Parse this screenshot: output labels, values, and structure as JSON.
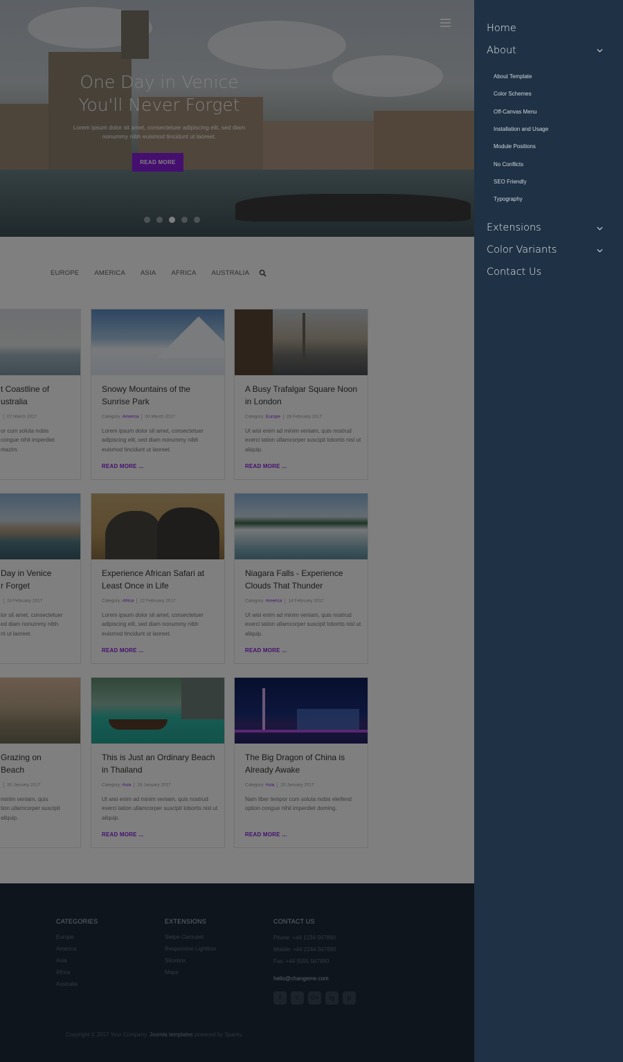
{
  "hero": {
    "title_line1": "One Day in Venice",
    "title_line2": "You'll Never Forget",
    "subtitle": "Lorem ipsum dolor sit amet, consectetuer adipiscing elit, sed diam nonummy nibh euismod tincidunt ut laoreet.",
    "button_label": "READ MORE",
    "slides": 5,
    "active_slide": 3
  },
  "tabs": [
    "EUROPE",
    "AMERICA",
    "ASIA",
    "AFRICA",
    "AUSTRALIA"
  ],
  "icons": {
    "menu": "hamburger-icon",
    "search": "search-icon",
    "expand": "chevron-down-icon"
  },
  "cards": [
    {
      "title": "t Coastline of\nustralia",
      "category_label": "",
      "category": "",
      "date": "07 March 2017",
      "text": "or cum soluta nobis\ncongue nihil imperdiet\nmazim.",
      "more": "",
      "image": "cliff-coast"
    },
    {
      "title": "Snowy Mountains of the Sunrise Park",
      "category_label": "Category:",
      "category": "America",
      "date": "03 March 2017",
      "text": "Lorem ipsum dolor sit amet, consectetuer adipiscing elit, sed diam nonummy nibh euismod tincidunt ut laoreet.",
      "more": "READ MORE ...",
      "image": "snow-mountain"
    },
    {
      "title": "A Busy Trafalgar Square Noon in London",
      "category_label": "Category:",
      "category": "Europe",
      "date": "28 February 2017",
      "text": "Ut wisi enim ad minim veniam, quis nostrud exerci tation ullamcorper suscipit lobortis nisl ut aliquip.",
      "more": "READ MORE ...",
      "image": "london-square"
    },
    {
      "title": "Day in Venice\nr Forget",
      "category_label": "",
      "category": "",
      "date": "24 February 2017",
      "text": "lor sit amet, consectetuer\ned diam nonummy nibh\nnt ut laoreet.",
      "more": "",
      "image": "venice"
    },
    {
      "title": "Experience African Safari at Least Once in Life",
      "category_label": "Category:",
      "category": "Africa",
      "date": "22 February 2017",
      "text": "Lorem ipsum dolor sit amet, consectetuer adipiscing elit, sed diam nonummy nibh euismod tincidunt ut laoreet.",
      "more": "READ MORE ...",
      "image": "elephants"
    },
    {
      "title": "Niagara Falls - Experience Clouds That Thunder",
      "category_label": "Category:",
      "category": "America",
      "date": "14 February 2017",
      "text": "Ut wisi enim ad minim veniam, quis nostrud exerci tation ullamcorper suscipit lobortis nisl ut aliquip.",
      "more": "READ MORE ...",
      "image": "waterfall"
    },
    {
      "title": "Grazing on\nBeach",
      "category_label": "",
      "category": "",
      "date": "30 January 2017",
      "text": "minim veniam, quis\ntion ullamcorper suscipit\naliquip.",
      "more": "",
      "image": "kangaroos"
    },
    {
      "title": "This is Just an Ordinary Beach in Thailand",
      "category_label": "Category:",
      "category": "Asia",
      "date": "28 January 2017",
      "text": "Ut wisi enim ad minim veniam, quis nostrud exerci tation ullamcorper suscipit lobortis nisl ut aliquip.",
      "more": "READ MORE ...",
      "image": "thai-beach"
    },
    {
      "title": "The Big Dragon of China is Already Awake",
      "category_label": "Category:",
      "category": "Asia",
      "date": "20 January 2017",
      "text": "Nam liber tempor cum soluta nobis eleifend option congue nihil imperdiet doming.",
      "more": "READ MORE ...",
      "image": "city-night"
    }
  ],
  "footer": {
    "categories_title": "CATEGORIES",
    "categories": [
      "Europe",
      "America",
      "Asia",
      "Africa",
      "Australia"
    ],
    "extensions_title": "EXTENSIONS",
    "extensions": [
      "Swipe Carousel",
      "Responsive Lightbox",
      "Slicebox",
      "Maps"
    ],
    "contact_title": "CONTACT US",
    "phone": "Phone: +44 1234 567890",
    "mobile": "Mobile: +44 2244 567890",
    "fax": "Fax: +44 5555 567890",
    "email": "hello@changeme.com",
    "social": [
      "f",
      "t",
      "G+",
      "ig",
      "p"
    ],
    "copyright_pre": "Copyright © 2017 Your Company.",
    "copyright_link": "Joomla templates",
    "copyright_post": "powered by Sparky."
  },
  "offcanvas": {
    "home": "Home",
    "about": "About",
    "about_items": [
      "About Template",
      "Color Schemes",
      "Off-Canvas Menu",
      "Installation and Usage",
      "Module Positions",
      "No Conflicts",
      "SEO Friendly",
      "Typography"
    ],
    "extensions": "Extensions",
    "color_variants": "Color Variants",
    "contact": "Contact Us"
  },
  "colors": {
    "accent": "#8a1fe0",
    "panel": "#1f3144",
    "footer": "#1d2b3b"
  }
}
